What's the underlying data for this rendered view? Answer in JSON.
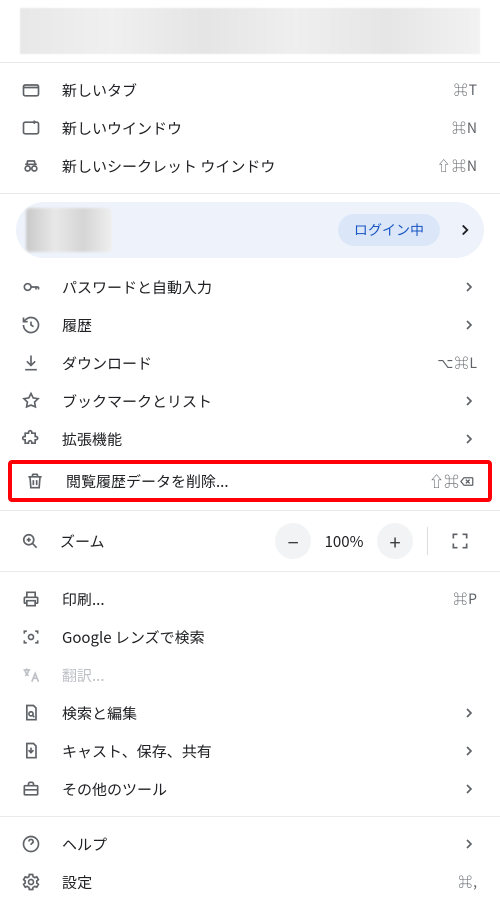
{
  "menu": {
    "new_tab": {
      "label": "新しいタブ",
      "shortcut": "⌘T"
    },
    "new_window": {
      "label": "新しいウインドウ",
      "shortcut": "⌘N"
    },
    "new_incognito": {
      "label": "新しいシークレット ウインドウ",
      "shortcut": "⇧⌘N"
    },
    "account": {
      "login_badge": "ログイン中"
    },
    "passwords": {
      "label": "パスワードと自動入力"
    },
    "history": {
      "label": "履歴"
    },
    "downloads": {
      "label": "ダウンロード",
      "shortcut": "⌥⌘L"
    },
    "bookmarks": {
      "label": "ブックマークとリスト"
    },
    "extensions": {
      "label": "拡張機能"
    },
    "clear_data": {
      "label": "閲覧履歴データを削除...",
      "shortcut": "⇧⌘⌫"
    },
    "zoom": {
      "label": "ズーム",
      "value": "100%"
    },
    "print": {
      "label": "印刷...",
      "shortcut": "⌘P"
    },
    "lens": {
      "label": "Google レンズで検索"
    },
    "translate": {
      "label": "翻訳..."
    },
    "find_edit": {
      "label": "検索と編集"
    },
    "cast_save_share": {
      "label": "キャスト、保存、共有"
    },
    "more_tools": {
      "label": "その他のツール"
    },
    "help": {
      "label": "ヘルプ"
    },
    "settings": {
      "label": "設定",
      "shortcut": "⌘,"
    }
  }
}
